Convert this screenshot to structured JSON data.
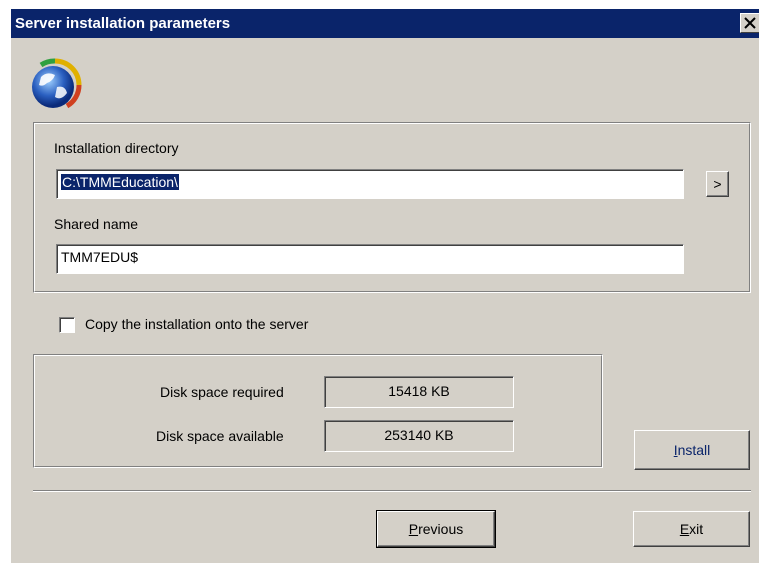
{
  "window": {
    "title": "Server installation parameters",
    "close_glyph": "✕"
  },
  "icons": {
    "logo": "globe-icon",
    "close": "close-icon"
  },
  "install_group": {
    "directory_label": "Installation directory",
    "directory_value": "C:\\TMMEducation\\",
    "browse_label": ">",
    "shared_label": "Shared name",
    "shared_value": "TMM7EDU$"
  },
  "copy_option": {
    "label": "Copy the installation onto the server",
    "checked": false
  },
  "disk_group": {
    "required_label": "Disk space required",
    "required_value": "15418 KB",
    "available_label": "Disk space available",
    "available_value": "253140 KB"
  },
  "buttons": {
    "install_mnemonic": "I",
    "install_rest": "nstall",
    "previous_mnemonic": "P",
    "previous_rest": "revious",
    "exit_mnemonic": "E",
    "exit_rest": "xit"
  },
  "colors": {
    "titlebar": "#0a246a",
    "dialog_face": "#d4d0c8",
    "selection": "#0a246a"
  }
}
